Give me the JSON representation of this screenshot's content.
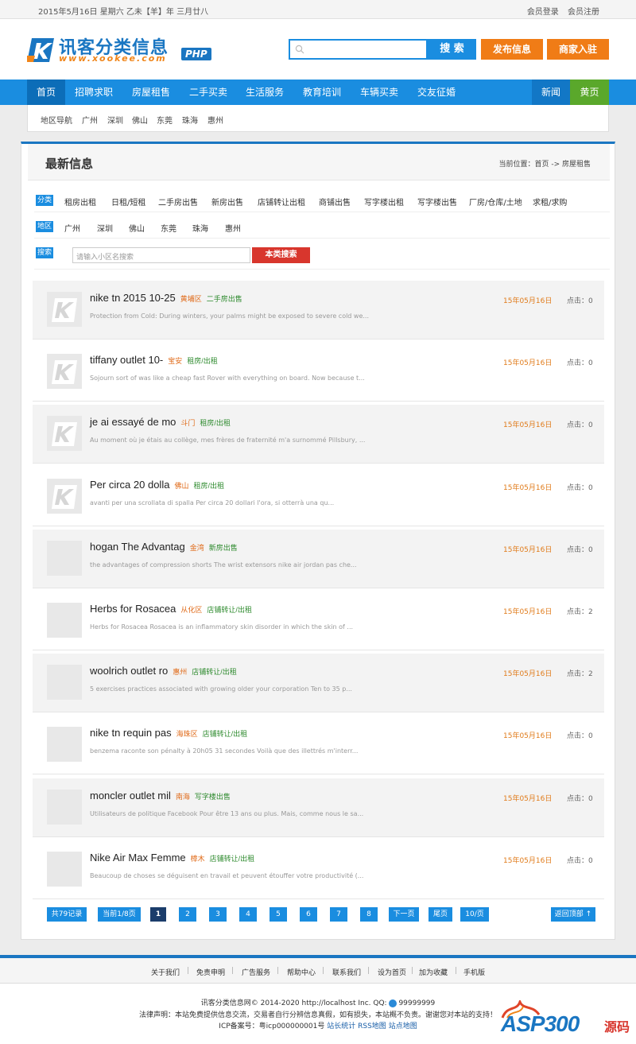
{
  "topbar": {
    "date": "2015年5月16日 星期六 乙未【羊】年 三月廿八",
    "login": "会员登录",
    "register": "会员注册"
  },
  "logo": {
    "title": "讯客分类信息",
    "sub": "www.xookee.com",
    "badge": "PHP"
  },
  "search": {
    "placeholder": "",
    "button": "搜 索"
  },
  "actions": {
    "publish": "发布信息",
    "merchant": "商家入驻"
  },
  "nav": {
    "items": [
      "首页",
      "招聘求职",
      "房屋租售",
      "二手买卖",
      "生活服务",
      "教育培训",
      "车辆买卖",
      "交友征婚"
    ],
    "news": "新闻",
    "yellow": "黄页"
  },
  "region_nav": [
    "地区导航",
    "广州",
    "深圳",
    "佛山",
    "东莞",
    "珠海",
    "惠州"
  ],
  "panel": {
    "title": "最新信息",
    "breadcrumb": "当前位置：首页 -> 房屋租售"
  },
  "filters": {
    "category_tag": "分类",
    "categories": [
      "租房出租",
      "日租/短租",
      "二手房出售",
      "新房出售",
      "店铺转让出租",
      "商铺出售",
      "写字楼出租",
      "写字楼出售",
      "厂房/仓库/土地",
      "求租/求购"
    ],
    "area_tag": "地区",
    "areas": [
      "广州",
      "深圳",
      "佛山",
      "东莞",
      "珠海",
      "惠州"
    ],
    "search_tag": "搜索",
    "search_placeholder": "请输入小区名搜索",
    "search_button": "本类搜索"
  },
  "listings": [
    {
      "title": "nike tn 2015 10-25",
      "area": "黄埔区",
      "category": "二手房出售",
      "desc": "Protection from Cold: During winters, your palms might be exposed to severe cold we...",
      "date": "15年05月16日",
      "clicks": "点击：0",
      "logo_thumb": true
    },
    {
      "title": "tiffany outlet 10-",
      "area": "宝安",
      "category": "租房/出租",
      "desc": "Sojourn sort of was like a cheap fast Rover with everything on board. Now because t...",
      "date": "15年05月16日",
      "clicks": "点击：0",
      "logo_thumb": true
    },
    {
      "title": "je ai essayé de mo",
      "area": "斗门",
      "category": "租房/出租",
      "desc": "Au moment où je étais au collège, mes frères de fraternité m'a surnommé Pillsbury, ...",
      "date": "15年05月16日",
      "clicks": "点击：0",
      "logo_thumb": true
    },
    {
      "title": "Per circa 20 dolla",
      "area": "佛山",
      "category": "租房/出租",
      "desc": "avanti per una scrollata di spalla Per circa 20 dollari l'ora, si otterrà una qu...",
      "date": "15年05月16日",
      "clicks": "点击：0",
      "logo_thumb": true
    },
    {
      "title": "hogan The Advantag",
      "area": "金湾",
      "category": "新房出售",
      "desc": "the advantages of compression shorts The wrist extensors nike air jordan pas che...",
      "date": "15年05月16日",
      "clicks": "点击：0",
      "logo_thumb": false
    },
    {
      "title": "Herbs for Rosacea",
      "area": "从化区",
      "category": "店铺转让/出租",
      "desc": "Herbs for Rosacea Rosacea is an inflammatory skin disorder in which the skin of ...",
      "date": "15年05月16日",
      "clicks": "点击：2",
      "logo_thumb": false
    },
    {
      "title": "woolrich outlet ro",
      "area": "惠州",
      "category": "店铺转让/出租",
      "desc": "5 exercises practices associated with growing older your corporation Ten to 35 p...",
      "date": "15年05月16日",
      "clicks": "点击：2",
      "logo_thumb": false
    },
    {
      "title": "nike tn requin pas",
      "area": "海珠区",
      "category": "店铺转让/出租",
      "desc": "benzema raconte son pénalty à 20h05 31 secondes Voilà que des illettrés m'interr...",
      "date": "15年05月16日",
      "clicks": "点击：0",
      "logo_thumb": false
    },
    {
      "title": "moncler outlet mil",
      "area": "南海",
      "category": "写字楼出售",
      "desc": "Utilisateurs de politique Facebook Pour être 13 ans ou plus. Mais, comme nous le sa...",
      "date": "15年05月16日",
      "clicks": "点击：0",
      "logo_thumb": false
    },
    {
      "title": "Nike Air Max Femme",
      "area": "樟木",
      "category": "店铺转让/出租",
      "desc": "Beaucoup de choses se déguisent en travail et peuvent étouffer votre productivité (...",
      "date": "15年05月16日",
      "clicks": "点击：0",
      "logo_thumb": false
    }
  ],
  "pager": {
    "total": "共79记录",
    "current": "当前1/8页",
    "pages": [
      "1",
      "2",
      "3",
      "4",
      "5",
      "6",
      "7",
      "8"
    ],
    "next": "下一页",
    "last": "尾页",
    "per": "10/页",
    "top": "返回顶部 ↑"
  },
  "footer": {
    "links": [
      "关于我们",
      "免责申明",
      "广告服务",
      "帮助中心",
      "联系我们",
      "设为首页",
      "加为收藏",
      "手机版"
    ],
    "copyright": "讯客分类信息网© 2014-2020 http://localhost Inc. QQ: ",
    "qq": "99999999",
    "disclaimer": "法律声明：本站免费提供信息交流，交易者自行分辨信息真假，如有损失，本站概不负责。谢谢您对本站的支持！",
    "icp": "ICP备案号：粤icp000000001号",
    "stats": "站长统计",
    "rss": "RSS地图",
    "sitemap": "站点地图"
  },
  "watermark": {
    "brand": "ASP300",
    "suffix": "源码"
  },
  "colors": {
    "primary": "#1a8de0",
    "orange": "#f07c16",
    "red": "#d8362d",
    "green": "#5aa82b"
  }
}
